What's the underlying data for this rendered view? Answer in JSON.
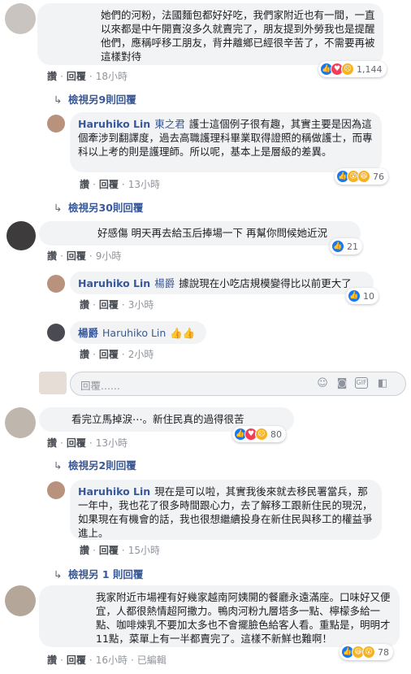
{
  "c1": {
    "text": "她們的河粉，法國麵包都好好吃，我們家附近也有一間，一直以來都是中午開賣沒多久就賣完了，朋友提到外勞我也是提醒他們，應稱呼移工朋友，背井離鄉已經很辛苦了，不需要再被這樣對待",
    "like": "讚",
    "reply": "回覆",
    "time": "18小時",
    "reactions": "1,144"
  },
  "more1": "檢視另9則回覆",
  "r1": {
    "name": "Haruhiko Lin",
    "tag": "東之君",
    "text": "護士這個例子很有趣，其實主要是因為這個牽涉到翻譯度，過去高職護理科畢業取得證照的稱做護士，而專科以上考的則是護理師。所以呢，基本上是層級的差異。",
    "like": "讚",
    "reply": "回覆",
    "time": "13小時",
    "reactions": "76"
  },
  "more2": "檢視另30則回覆",
  "c2": {
    "text": "好感傷 明天再去給玉后捧場一下 再幫你問候她近況",
    "like": "讚",
    "reply": "回覆",
    "time": "9小時",
    "reactions": "21"
  },
  "r2": {
    "name": "Haruhiko Lin",
    "tag": "楊爵",
    "text": "據說現在小吃店規模變得比以前更大了",
    "like": "讚",
    "reply": "回覆",
    "time": "3小時",
    "reactions": "10"
  },
  "r3": {
    "name": "楊爵",
    "tag": "Haruhiko Lin",
    "emoji": "👍👍",
    "like": "讚",
    "reply": "回覆",
    "time": "2小時"
  },
  "replybox": {
    "placeholder": "回覆......"
  },
  "c3": {
    "text": "看完立馬掉淚⋯。新住民真的過得很苦",
    "like": "讚",
    "reply": "回覆",
    "time": "13小時",
    "reactions": "80"
  },
  "more3": "檢視另2則回覆",
  "r4": {
    "name": "Haruhiko Lin",
    "text": "現在是可以啦，其實我後來就去移民署當兵，那一年中，我也花了很多時間跟心力，去了解移工跟新住民的現況，如果現在有機會的話，我也很想繼續投身在新住民與移工的權益爭進上。",
    "like": "讚",
    "reply": "回覆",
    "time": "15小時"
  },
  "more4": "檢視另 1 則回覆",
  "c4": {
    "text": "我家附近市場裡有好幾家越南阿姨開的餐廳永遠滿座。口味好又便宜，人都很熱情超阿撒力。鴨肉河粉九層塔多一點、檸檬多給一點、咖啡煉乳不要加太多也不會擺臉色給客人看。重點是，明明才11點，菜單上有一半都賣完了。這樣不新鮮也難啊！",
    "like": "讚",
    "reply": "回覆",
    "time": "16小時",
    "edited": "已編輯",
    "reactions": "78"
  }
}
